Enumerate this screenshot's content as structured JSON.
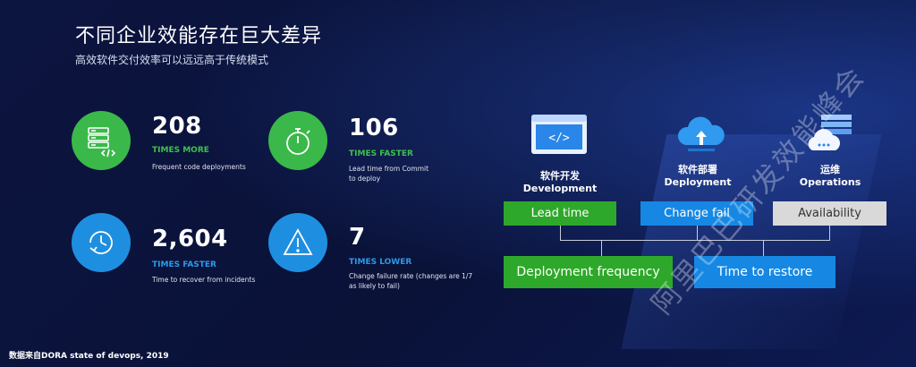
{
  "title": "不同企业效能存在巨大差异",
  "subtitle": "高效软件交付效率可以远远高于传统模式",
  "stats": [
    {
      "number": "208",
      "tag": "TIMES MORE",
      "desc": "Frequent code deployments",
      "color": "#3bb84a",
      "icon": "server-code-icon"
    },
    {
      "number": "106",
      "tag": "TIMES FASTER",
      "desc": "Lead time from Commit to deploy",
      "color": "#3bb84a",
      "icon": "stopwatch-icon"
    },
    {
      "number": "2,604",
      "tag": "TIMES FASTER",
      "desc": "Time to recover from incidents",
      "color": "#1e8fe0",
      "icon": "clock-refresh-icon"
    },
    {
      "number": "7",
      "tag": "TIMES LOWER",
      "desc": "Change failure rate (changes are 1/7 as likely to fail)",
      "color": "#1e8fe0",
      "icon": "warning-icon"
    }
  ],
  "stages": [
    {
      "zh": "软件开发",
      "en": "Development",
      "icon": "code-window-icon"
    },
    {
      "zh": "软件部署",
      "en": "Deployment",
      "icon": "cloud-upload-icon"
    },
    {
      "zh": "运维",
      "en": "Operations",
      "icon": "cloud-server-icon"
    }
  ],
  "metrics": {
    "lead_time": "Lead time",
    "change_fail": "Change fail",
    "availability": "Availability",
    "deployment_frequency": "Deployment frequency",
    "time_to_restore": "Time to restore"
  },
  "watermark": "阿里巴巴研发效能峰会",
  "source": "数据来自DORA state of devops, 2019",
  "colors": {
    "green": "#2ea82a",
    "blue": "#1688e4",
    "gray": "#d9d9d9",
    "background": "#0a1238"
  }
}
